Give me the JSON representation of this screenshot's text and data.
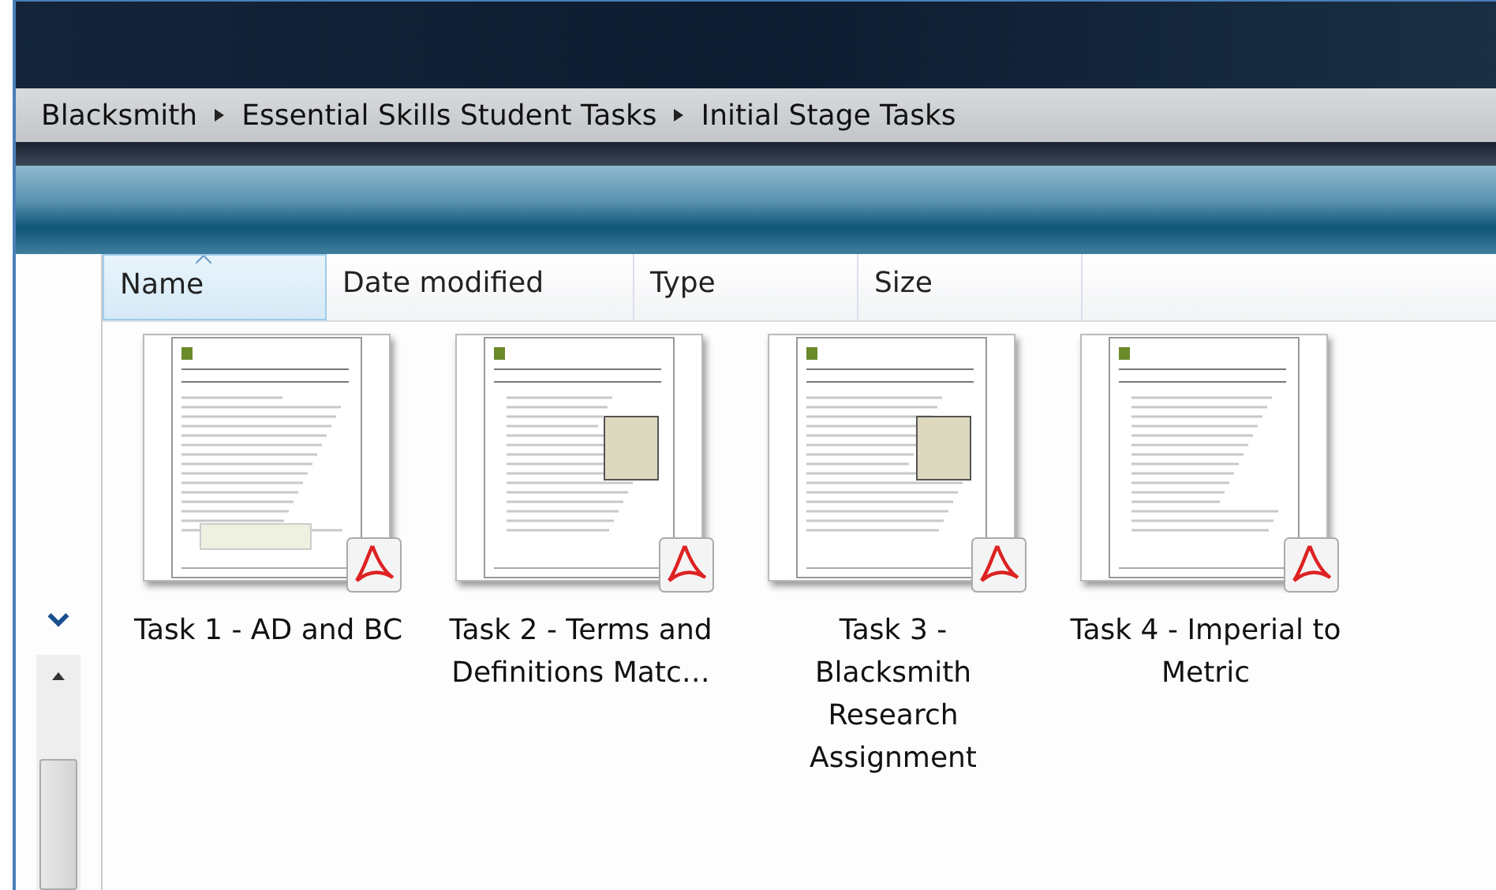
{
  "breadcrumb": [
    "Blacksmith",
    "Essential Skills Student Tasks",
    "Initial Stage Tasks"
  ],
  "columns": [
    {
      "label": "Name",
      "selected": true,
      "sorted": true
    },
    {
      "label": "Date modified",
      "selected": false,
      "sorted": false
    },
    {
      "label": "Type",
      "selected": false,
      "sorted": false
    },
    {
      "label": "Size",
      "selected": false,
      "sorted": false
    }
  ],
  "files": [
    {
      "name": "Task 1 - AD and BC",
      "kind": "pdf"
    },
    {
      "name": "Task 2 - Terms and Definitions Matc…",
      "kind": "pdf"
    },
    {
      "name": "Task 3 - Blacksmith Research Assignment",
      "kind": "pdf"
    },
    {
      "name": "Task 4 - Imperial to Metric",
      "kind": "pdf"
    }
  ]
}
